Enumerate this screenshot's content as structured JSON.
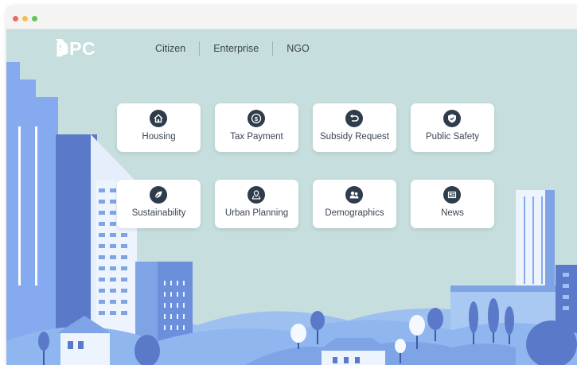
{
  "header": {
    "logo_text": "BPC",
    "nav": [
      {
        "label": "Citizen"
      },
      {
        "label": "Enterprise"
      },
      {
        "label": "NGO"
      }
    ]
  },
  "services": [
    {
      "label": "Housing",
      "icon": "house-icon"
    },
    {
      "label": "Tax Payment",
      "icon": "dollar-coin-icon"
    },
    {
      "label": "Subsidy Request",
      "icon": "return-arrow-icon"
    },
    {
      "label": "Public Safety",
      "icon": "shield-icon"
    },
    {
      "label": "Sustainability",
      "icon": "leaf-icon"
    },
    {
      "label": "Urban Planning",
      "icon": "map-pin-icon"
    },
    {
      "label": "Demographics",
      "icon": "people-icon"
    },
    {
      "label": "News",
      "icon": "newspaper-icon"
    }
  ],
  "colors": {
    "sky": "#c6dedd",
    "icon_bg": "#2e3c4c",
    "building_dark": "#5b79c9",
    "building_mid": "#7ea4e6",
    "building_light": "#a9c9f3",
    "hill": "#8fb6ef"
  }
}
